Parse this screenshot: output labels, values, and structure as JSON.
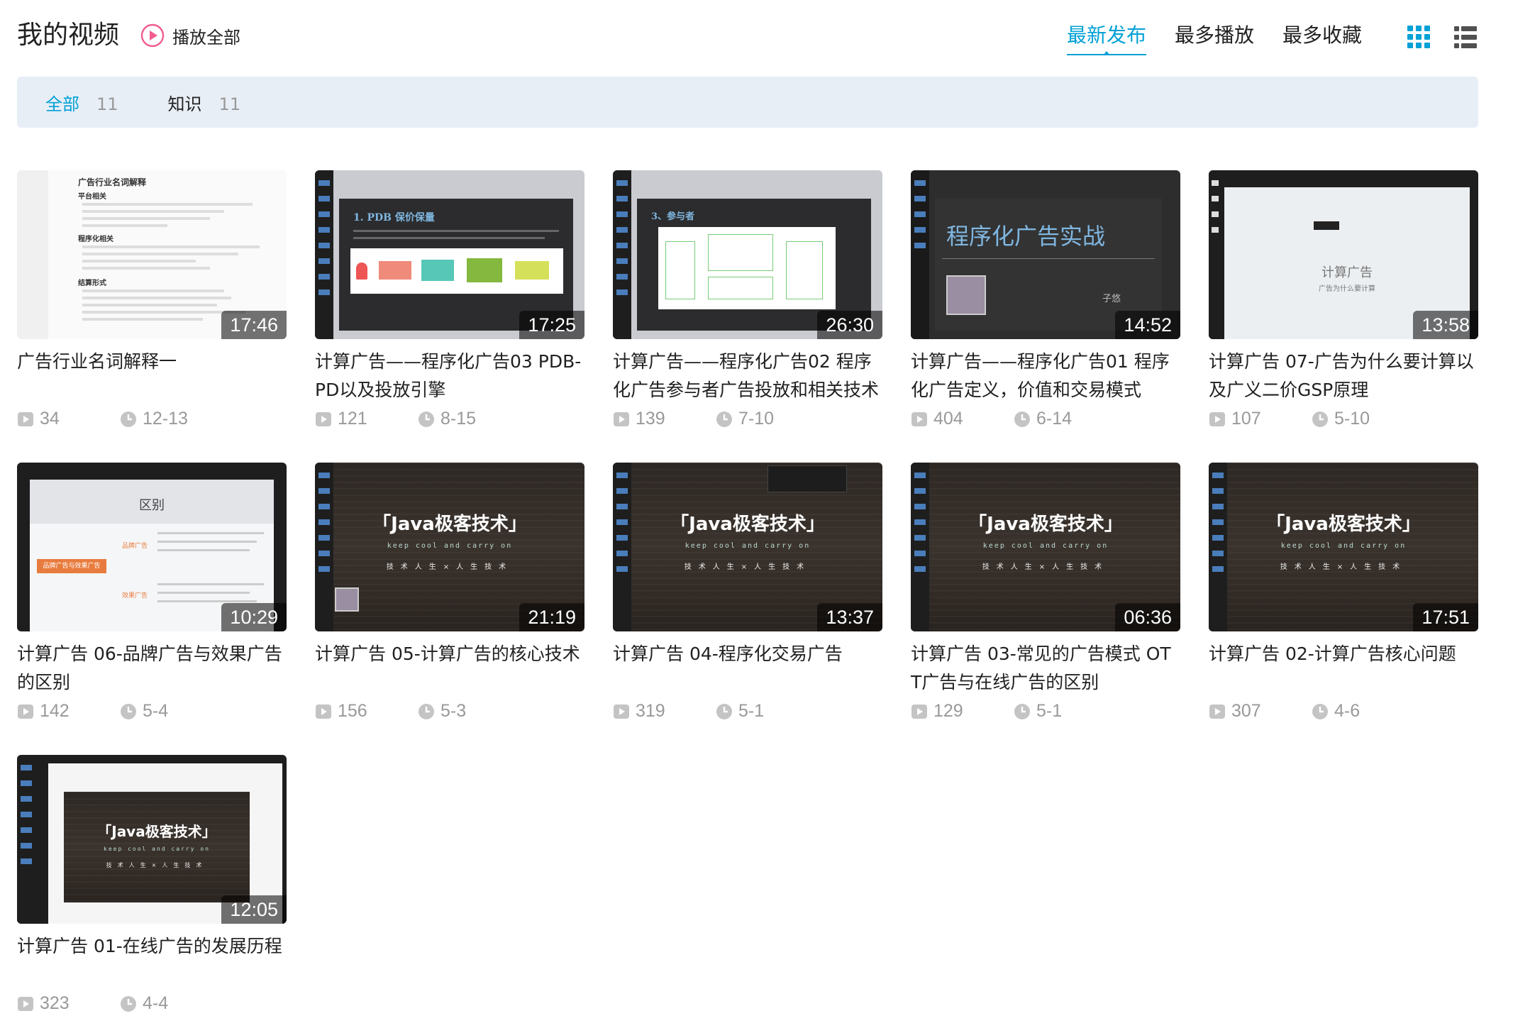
{
  "header": {
    "title": "我的视频",
    "play_all_label": "播放全部",
    "sort_tabs": [
      {
        "label": "最新发布",
        "active": true
      },
      {
        "label": "最多播放",
        "active": false
      },
      {
        "label": "最多收藏",
        "active": false
      }
    ],
    "view_icons": [
      "grid-view-icon",
      "list-view-icon"
    ],
    "accent_color": "#00a1d6"
  },
  "filters": [
    {
      "label": "全部",
      "count": "11",
      "active": true
    },
    {
      "label": "知识",
      "count": "11",
      "active": false
    }
  ],
  "videos": [
    {
      "title": "广告行业名词解释一",
      "duration": "17:46",
      "plays": "34",
      "date": "12-13",
      "thumb": {
        "heading": "广告行业名词解释",
        "sub": "平台相关",
        "sub2": "程序化相关",
        "sub3": "结算形式"
      }
    },
    {
      "title": "计算广告——程序化广告03 PDB-PD以及投放引擎",
      "duration": "17:25",
      "plays": "121",
      "date": "8-15",
      "thumb": {
        "heading": "1. PDB 保价保量"
      }
    },
    {
      "title": "计算广告——程序化广告02 程序化广告参与者广告投放和相关技术",
      "duration": "26:30",
      "plays": "139",
      "date": "7-10",
      "thumb": {
        "heading": "3、参与者"
      }
    },
    {
      "title": "计算广告——程序化广告01 程序化广告定义，价值和交易模式",
      "duration": "14:52",
      "plays": "404",
      "date": "6-14",
      "thumb": {
        "heading": "程序化广告实战",
        "author": "子悠"
      }
    },
    {
      "title": "计算广告 07-广告为什么要计算以及广义二价GSP原理",
      "duration": "13:58",
      "plays": "107",
      "date": "5-10",
      "thumb": {
        "heading": "计算广告",
        "sub": "广告为什么要计算"
      }
    },
    {
      "title": "计算广告 06-品牌广告与效果广告的区别",
      "duration": "10:29",
      "plays": "142",
      "date": "5-4",
      "thumb": {
        "heading": "区别",
        "node": "品牌广告与效果广告",
        "branch1": "品牌广告",
        "branch2": "效果广告"
      }
    },
    {
      "title": "计算广告 05-计算广告的核心技术",
      "duration": "21:19",
      "plays": "156",
      "date": "5-3",
      "thumb": {
        "heading": "「Java极客技术」",
        "sub": "keep cool and carry on",
        "sub2": "技术人生×人生技术"
      }
    },
    {
      "title": "计算广告 04-程序化交易广告",
      "duration": "13:37",
      "plays": "319",
      "date": "5-1",
      "thumb": {
        "heading": "「Java极客技术」",
        "sub": "keep cool and carry on",
        "sub2": "技术人生×人生技术"
      }
    },
    {
      "title": "计算广告 03-常见的广告模式 OTT广告与在线广告的区别",
      "duration": "06:36",
      "plays": "129",
      "date": "5-1",
      "thumb": {
        "heading": "「Java极客技术」",
        "sub": "keep cool and carry on",
        "sub2": "技术人生×人生技术"
      }
    },
    {
      "title": "计算广告 02-计算广告核心问题",
      "duration": "17:51",
      "plays": "307",
      "date": "4-6",
      "thumb": {
        "heading": "「Java极客技术」",
        "sub": "keep cool and carry on",
        "sub2": "技术人生×人生技术"
      }
    },
    {
      "title": "计算广告 01-在线广告的发展历程",
      "duration": "12:05",
      "plays": "323",
      "date": "4-4",
      "thumb": {
        "heading": "「Java极客技术」",
        "sub": "keep cool and carry on",
        "sub2": "技术人生×人生技术"
      }
    }
  ]
}
